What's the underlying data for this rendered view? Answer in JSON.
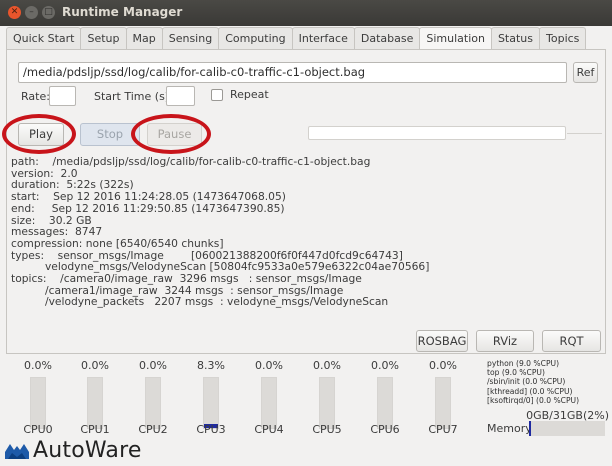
{
  "window": {
    "title": "Runtime Manager"
  },
  "tabs": [
    "Quick Start",
    "Setup",
    "Map",
    "Sensing",
    "Computing",
    "Interface",
    "Database",
    "Simulation",
    "Status",
    "Topics"
  ],
  "active_tab": "Simulation",
  "simulation": {
    "bag_path": "/media/pdsljp/ssd/log/calib/for-calib-c0-traffic-c1-object.bag",
    "ref_label": "Ref",
    "rate_label": "Rate:",
    "rate_value": "",
    "start_time_label": "Start Time (s):",
    "start_time_value": "",
    "repeat_label": "Repeat",
    "repeat_checked": false,
    "play_label": "Play",
    "stop_label": "Stop",
    "pause_label": "Pause",
    "progress": 0,
    "bag_info": [
      "path:    /media/pdsljp/ssd/log/calib/for-calib-c0-traffic-c1-object.bag",
      "version:  2.0",
      "duration:  5:22s (322s)",
      "start:    Sep 12 2016 11:24:28.05 (1473647068.05)",
      "end:     Sep 12 2016 11:29:50.85 (1473647390.85)",
      "size:    30.2 GB",
      "messages:  8747",
      "compression: none [6540/6540 chunks]",
      "types:    sensor_msgs/Image        [060021388200f6f0f447d0fcd9c64743]",
      "          velodyne_msgs/VelodyneScan [50804fc9533a0e579e6322c04ae70566]",
      "topics:    /camera0/image_raw  3296 msgs   : sensor_msgs/Image",
      "          /camera1/image_raw  3244 msgs  : sensor_msgs/Image",
      "          /velodyne_packets   2207 msgs  : velodyne_msgs/VelodyneScan"
    ],
    "rosbag_label": "ROSBAG",
    "rviz_label": "RViz",
    "rqt_label": "RQT"
  },
  "status": {
    "cpus": [
      {
        "name": "CPU0",
        "percent": "0.0%",
        "load": 0.0
      },
      {
        "name": "CPU1",
        "percent": "0.0%",
        "load": 0.0
      },
      {
        "name": "CPU2",
        "percent": "0.0%",
        "load": 0.0
      },
      {
        "name": "CPU3",
        "percent": "8.3%",
        "load": 0.083
      },
      {
        "name": "CPU4",
        "percent": "0.0%",
        "load": 0.0
      },
      {
        "name": "CPU5",
        "percent": "0.0%",
        "load": 0.0
      },
      {
        "name": "CPU6",
        "percent": "0.0%",
        "load": 0.0
      },
      {
        "name": "CPU7",
        "percent": "0.0%",
        "load": 0.0
      }
    ],
    "processes": [
      "python (9.0 %CPU)",
      "top (9.0 %CPU)",
      "/sbin/init (0.0 %CPU)",
      "[kthreadd] (0.0 %CPU)",
      "[ksoftirqd/0] (0.0 %CPU)"
    ],
    "memory_value": "0GB/31GB(2%)",
    "memory_label": "Memory",
    "memory_fraction": 0.02
  },
  "logo": {
    "text": "AutoWare"
  },
  "colors": {
    "accent_ring": "#c8141a",
    "usage_bar": "#1f2aa0",
    "titlebar": "#3a3936"
  }
}
